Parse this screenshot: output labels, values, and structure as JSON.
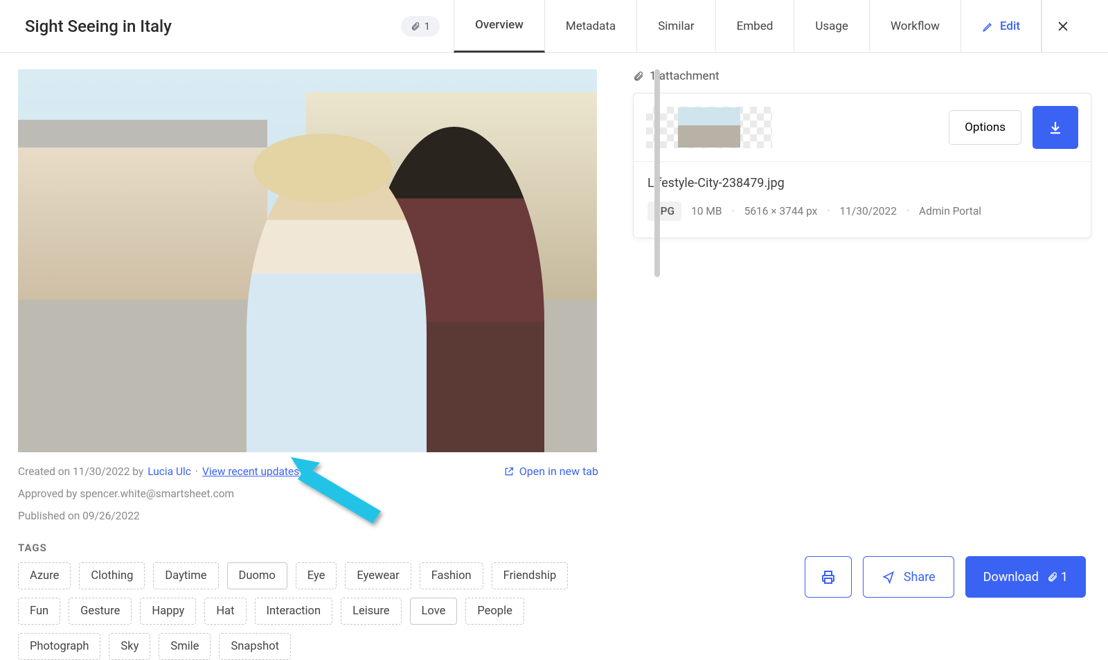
{
  "header": {
    "title": "Sight Seeing in Italy",
    "attachment_count": "1",
    "tabs": {
      "overview": "Overview",
      "metadata": "Metadata",
      "similar": "Similar",
      "embed": "Embed",
      "usage": "Usage",
      "workflow": "Workflow",
      "edit": "Edit"
    }
  },
  "meta": {
    "created_prefix": "Created on 11/30/2022 by ",
    "author": "Lucia Ulc",
    "sep": "·",
    "view_updates": "View recent updates",
    "approved": "Approved by spencer.white@smartsheet.com",
    "published": "Published on 09/26/2022",
    "open_tab": "Open in new tab"
  },
  "tags_header": "TAGS",
  "tags": [
    "Azure",
    "Clothing",
    "Daytime",
    "Duomo",
    "Eye",
    "Eyewear",
    "Fashion",
    "Friendship",
    "Fun",
    "Gesture",
    "Happy",
    "Hat",
    "Interaction",
    "Leisure",
    "Love",
    "People",
    "Photograph",
    "Sky",
    "Smile",
    "Snapshot"
  ],
  "solid_tags": [
    "Duomo",
    "Love"
  ],
  "attachments": {
    "header": "1 attachment",
    "options": "Options",
    "filename": "Lifestyle-City-238479.jpg",
    "badge": "JPG",
    "size": "10 MB",
    "dims": "5616 × 3744 px",
    "date": "11/30/2022",
    "portal": "Admin Portal"
  },
  "footer": {
    "share": "Share",
    "download": "Download",
    "dl_count": "1"
  }
}
